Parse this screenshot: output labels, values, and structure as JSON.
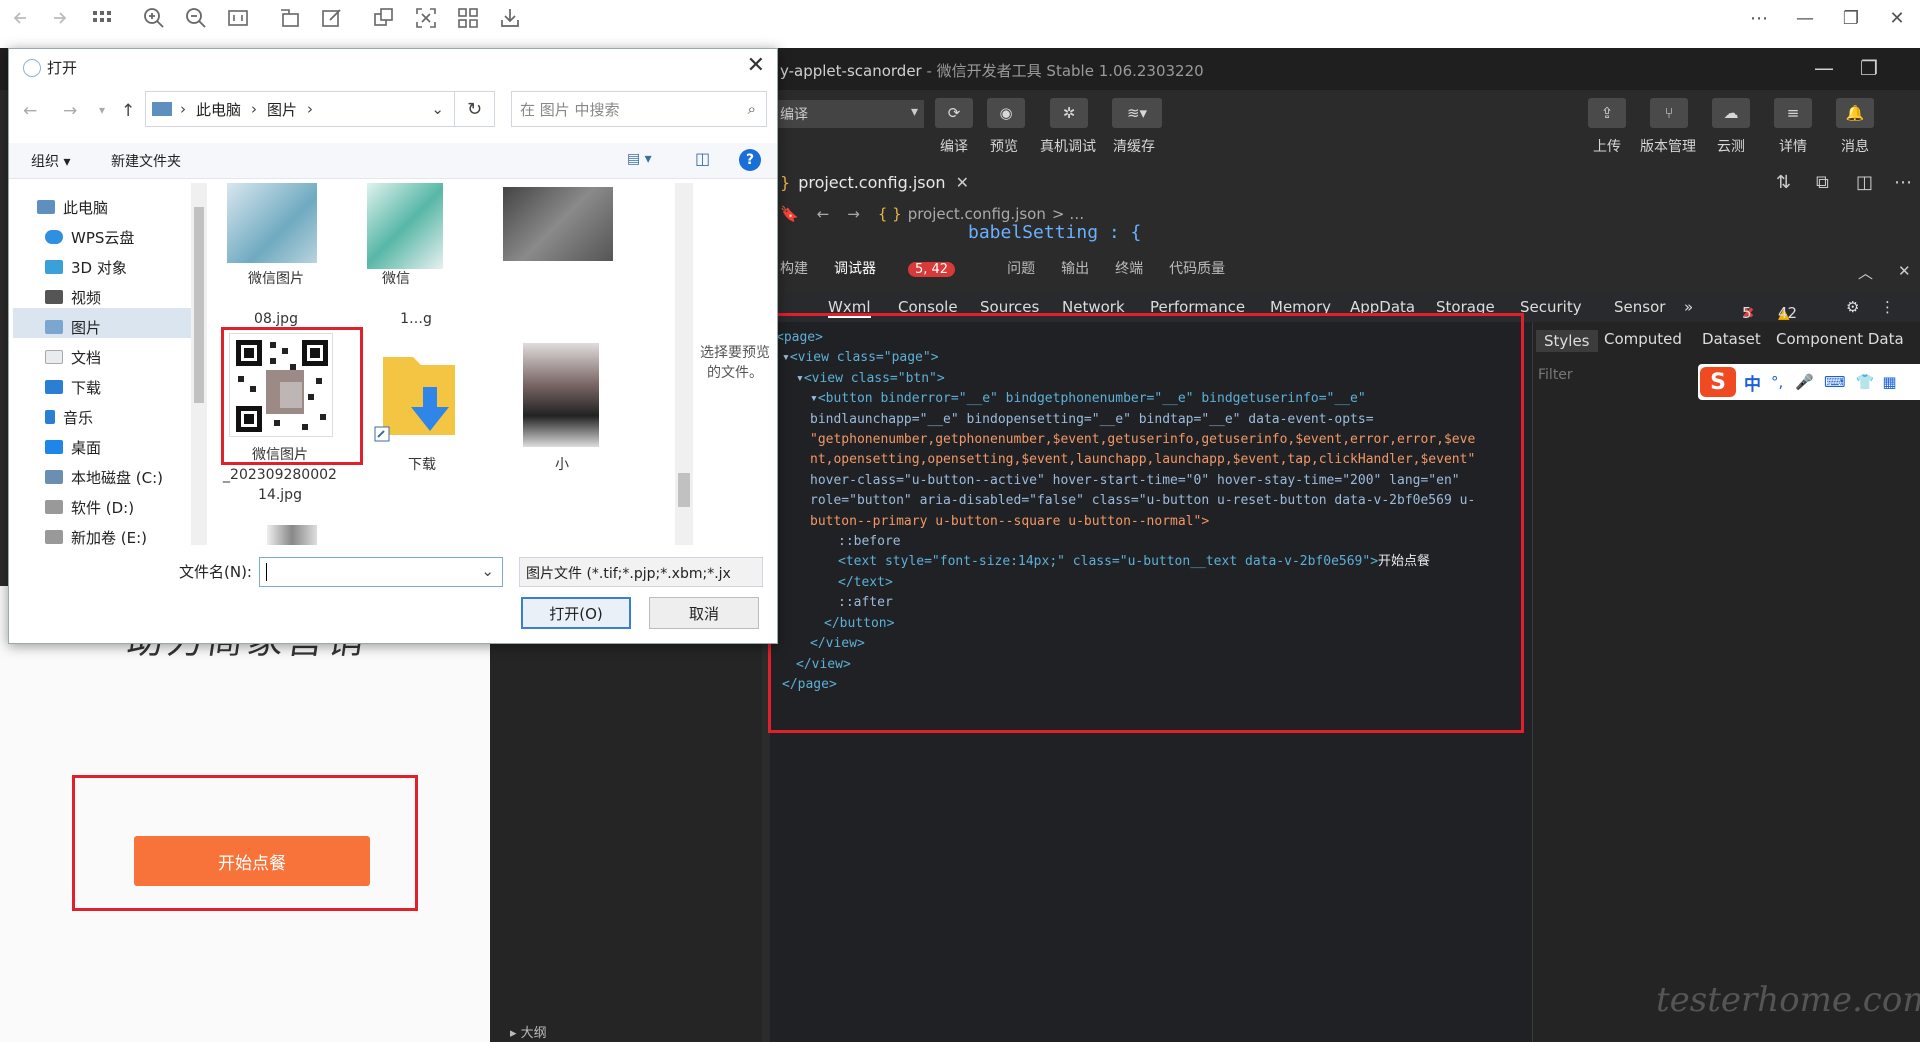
{
  "viewer": {
    "controls": [
      "⋯",
      "—",
      "❐",
      "✕"
    ]
  },
  "devtools": {
    "title_project": "y-applet-scanorder",
    "title_app": " - 微信开发者工具 Stable 1.06.2303220",
    "compile_select": "编译",
    "left_buttons": [
      "编译",
      "预览",
      "真机调试",
      "清缓存"
    ],
    "right_buttons": [
      "上传",
      "版本管理",
      "云测",
      "详情",
      "消息"
    ],
    "file_tab": "project.config.json",
    "breadcrumb": "project.config.json",
    "code_peek": "babelSetting : {",
    "debug_tabs": {
      "build": "构建",
      "debugger": "调试器",
      "badge": "5, 42",
      "issues": "问题",
      "output": "输出",
      "terminal": "终端",
      "quality": "代码质量"
    },
    "panel_tabs": [
      "Wxml",
      "Console",
      "Sources",
      "Network",
      "Performance",
      "Memory",
      "AppData",
      "Storage",
      "Security",
      "Sensor",
      "»"
    ],
    "errors": "5",
    "warnings": "42",
    "style_tabs": [
      "Styles",
      "Computed",
      "Dataset",
      "Component Data"
    ],
    "filter_placeholder": "Filter",
    "outline_label": "大纲",
    "ime_label": "中"
  },
  "wxml": {
    "page_open": "<page>",
    "view_page": "<view class=\"page\">",
    "view_btn": "<view class=\"btn\">",
    "button_l1": "<button binderror=\"__e\" bindgetphonenumber=\"__e\" bindgetuserinfo=\"__e\"",
    "button_l2": "bindlaunchapp=\"__e\" bindopensetting=\"__e\" bindtap=\"__e\" data-event-opts=",
    "button_l3": "\"getphonenumber,getphonenumber,$event,getuserinfo,getuserinfo,$event,error,error,$eve",
    "button_l4": "nt,opensetting,opensetting,$event,launchapp,launchapp,$event,tap,clickHandler,$event\"",
    "button_l5": "hover-class=\"u-button--active\" hover-start-time=\"0\" hover-stay-time=\"200\" lang=\"en\"",
    "button_l6": "role=\"button\" aria-disabled=\"false\" class=\"u-button u-reset-button data-v-2bf0e569 u-",
    "button_l7": "button--primary u-button--square u-button--normal\">",
    "before": "::before",
    "text_open": "<text style=\"font-size:14px;\" class=\"u-button__text data-v-2bf0e569\">",
    "text_value": "开始点餐",
    "text_close": "</text>",
    "after": "::after",
    "button_close": "</button>",
    "view_close1": "</view>",
    "view_close2": "</view>",
    "page_close": "</page>"
  },
  "simulator": {
    "slogan": "助力商家营销",
    "order_button": "开始点餐"
  },
  "dialog": {
    "title": "打开",
    "address": [
      "此电脑",
      "图片"
    ],
    "search_placeholder": "在 图片 中搜索",
    "organize": "组织",
    "new_folder": "新建文件夹",
    "tree": [
      "此电脑",
      "WPS云盘",
      "3D 对象",
      "视频",
      "图片",
      "文档",
      "下载",
      "音乐",
      "桌面",
      "本地磁盘 (C:)",
      "软件 (D:)",
      "新加卷 (E:)"
    ],
    "files": {
      "row1": [
        "微信图片",
        "微信",
        "08.jpg",
        "1…g"
      ],
      "qr_name_1": "微信图片",
      "qr_name_2": "_202309280002",
      "qr_name_3": "14.jpg",
      "folder_name": "下载",
      "third_name": "小"
    },
    "preview_note": "选择要预览的文件。",
    "filename_label": "文件名(N):",
    "filetype": "图片文件 (*.tif;*.pjp;*.xbm;*.jx",
    "open_button": "打开(O)",
    "cancel_button": "取消"
  },
  "watermark": "testerhome.com"
}
